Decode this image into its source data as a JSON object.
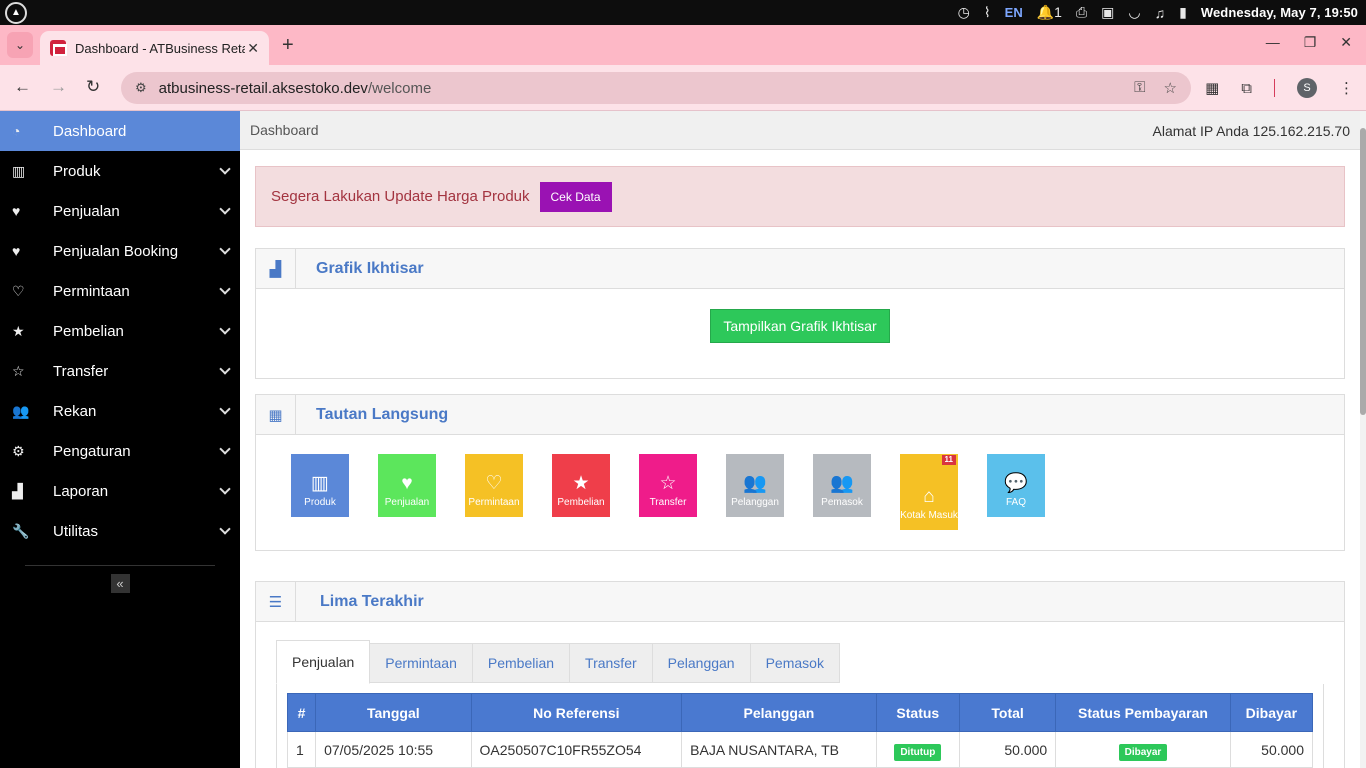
{
  "os": {
    "language": "EN",
    "notification_count": "1",
    "datetime": "Wednesday, May  7, 19:50"
  },
  "browser": {
    "tab_title": "Dashboard - ATBusiness Retail",
    "url_host": "atbusiness-retail.aksestoko.dev",
    "url_path": "/welcome",
    "profile_initial": "S"
  },
  "sidebar": {
    "items": [
      {
        "label": "Dashboard",
        "icon": "dashboard-icon",
        "glyph": "◔",
        "active": true,
        "caret": false
      },
      {
        "label": "Produk",
        "icon": "barcode-icon",
        "glyph": "▥",
        "caret": true
      },
      {
        "label": "Penjualan",
        "icon": "heart-icon",
        "glyph": "♥",
        "caret": true
      },
      {
        "label": "Penjualan Booking",
        "icon": "heart-icon",
        "glyph": "♥",
        "caret": true
      },
      {
        "label": "Permintaan",
        "icon": "heart-outline-icon",
        "glyph": "♡",
        "caret": true
      },
      {
        "label": "Pembelian",
        "icon": "star-icon",
        "glyph": "★",
        "caret": true
      },
      {
        "label": "Transfer",
        "icon": "star-outline-icon",
        "glyph": "☆",
        "caret": true
      },
      {
        "label": "Rekan",
        "icon": "users-icon",
        "glyph": "👥",
        "caret": true
      },
      {
        "label": "Pengaturan",
        "icon": "gear-icon",
        "glyph": "⚙",
        "caret": true
      },
      {
        "label": "Laporan",
        "icon": "bar-chart-icon",
        "glyph": "▟",
        "caret": true
      },
      {
        "label": "Utilitas",
        "icon": "wrench-icon",
        "glyph": "🔧",
        "caret": true
      }
    ],
    "collapse_glyph": "«"
  },
  "header": {
    "breadcrumb": "Dashboard",
    "ip_text": "Alamat IP Anda 125.162.215.70"
  },
  "alert": {
    "text": "Segera Lakukan Update Harga Produk",
    "button": "Cek Data"
  },
  "grafik": {
    "title": "Grafik Ikhtisar",
    "button": "Tampilkan Grafik Ikhtisar"
  },
  "tautan": {
    "title": "Tautan Langsung",
    "tiles": [
      {
        "label": "Produk",
        "glyph": "▥",
        "color": "#5b88d8",
        "icon": "barcode-icon"
      },
      {
        "label": "Penjualan",
        "glyph": "♥",
        "color": "#5ce65c",
        "icon": "heart-icon"
      },
      {
        "label": "Permintaan",
        "glyph": "♡",
        "color": "#f5c125",
        "icon": "heart-outline-icon"
      },
      {
        "label": "Pembelian",
        "glyph": "★",
        "color": "#ef3e4a",
        "icon": "star-icon"
      },
      {
        "label": "Transfer",
        "glyph": "☆",
        "color": "#ef1c8a",
        "icon": "star-outline-icon"
      },
      {
        "label": "Pelanggan",
        "glyph": "👥",
        "color": "#b6babf",
        "icon": "users-icon"
      },
      {
        "label": "Pemasok",
        "glyph": "👥",
        "color": "#b6babf",
        "icon": "users-icon"
      },
      {
        "label": "Kotak Masuk",
        "glyph": "⌂",
        "color": "#f5c125",
        "icon": "inbox-icon",
        "badge": "11"
      },
      {
        "label": "FAQ",
        "glyph": "💬",
        "color": "#5bc0eb",
        "icon": "comments-icon"
      }
    ]
  },
  "lima": {
    "title": "Lima Terakhir",
    "tabs": [
      "Penjualan",
      "Permintaan",
      "Pembelian",
      "Transfer",
      "Pelanggan",
      "Pemasok"
    ],
    "active_tab": 0,
    "columns": [
      "#",
      "Tanggal",
      "No Referensi",
      "Pelanggan",
      "Status",
      "Total",
      "Status Pembayaran",
      "Dibayar"
    ],
    "rows": [
      {
        "no": "1",
        "tanggal": "07/05/2025 10:55",
        "ref": "OA250507C10FR55ZO54",
        "pelanggan": "BAJA NUSANTARA, TB",
        "status": "Ditutup",
        "total": "50.000",
        "status_bayar": "Dibayar",
        "dibayar": "50.000"
      }
    ]
  },
  "colors": {
    "accent": "#4a79c6",
    "sidebar_active": "#5b88d8",
    "browser_tab_strip": "#fdb8c6",
    "alert_text": "#a33440",
    "purple_button": "#9a12b3",
    "green_button": "#2dc85a"
  }
}
